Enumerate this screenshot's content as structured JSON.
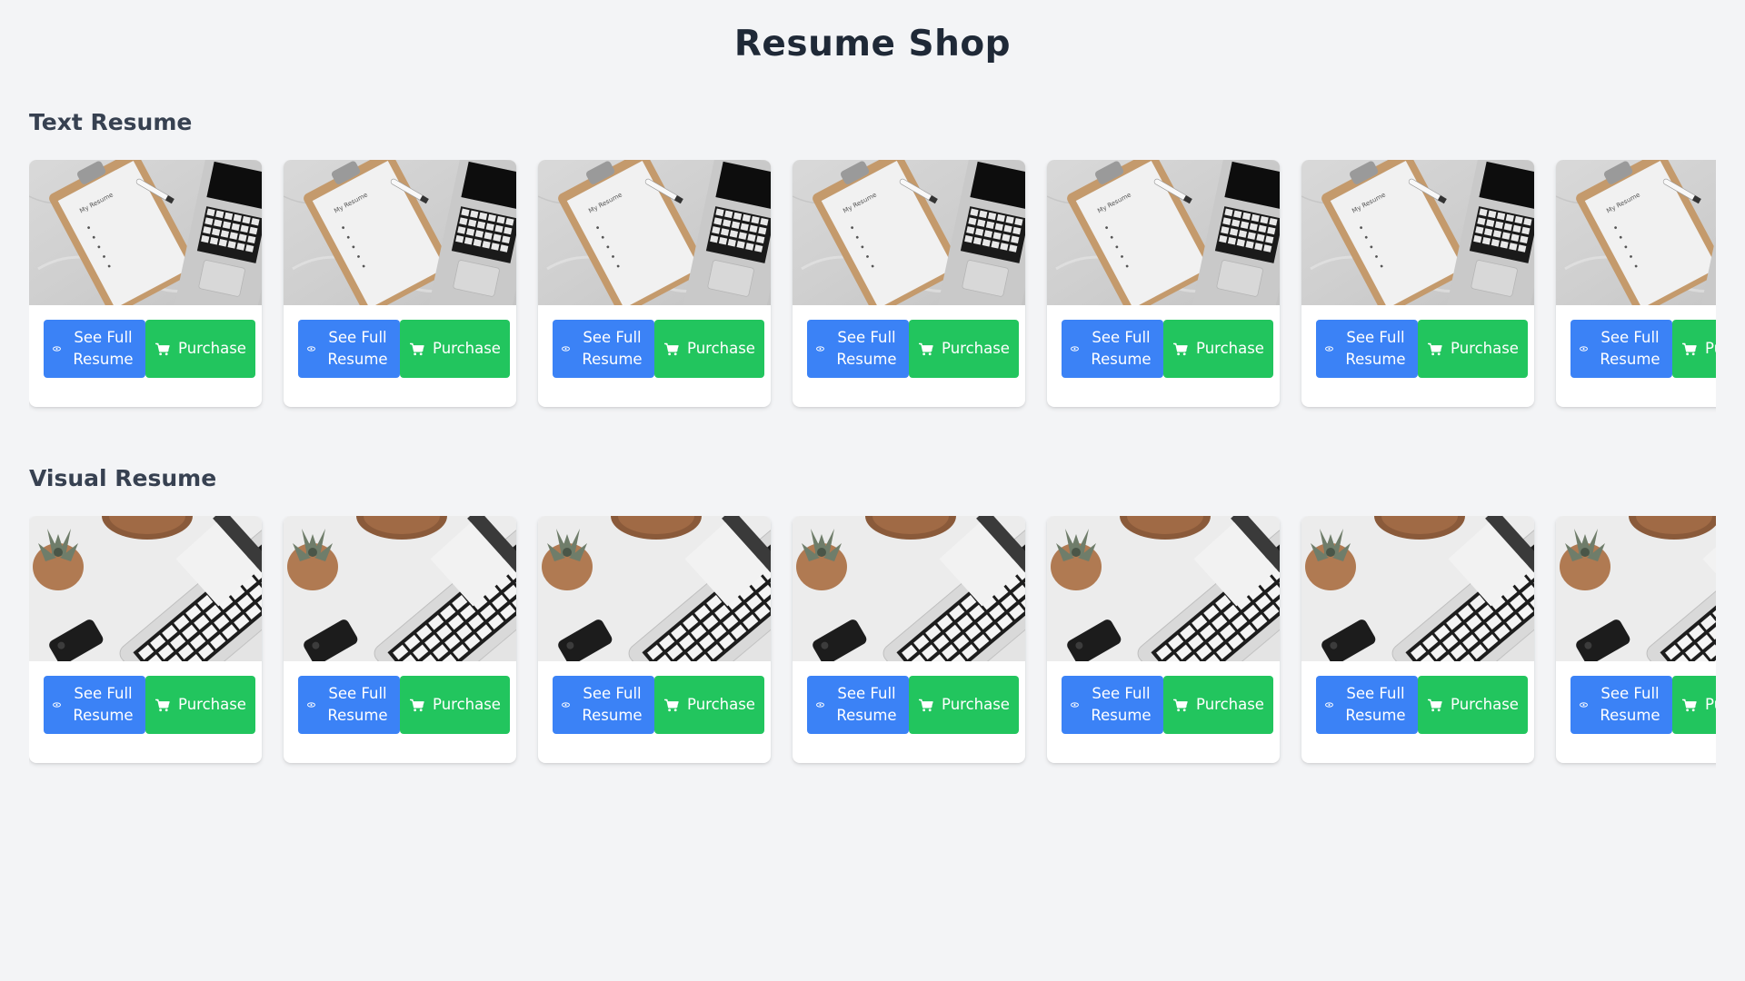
{
  "page": {
    "title": "Resume Shop"
  },
  "sections": [
    {
      "title": "Text Resume",
      "image_kind": "clipboard-laptop",
      "cards": [
        {
          "view_label": "See Full Resume",
          "buy_label": "Purchase"
        },
        {
          "view_label": "See Full Resume",
          "buy_label": "Purchase"
        },
        {
          "view_label": "See Full Resume",
          "buy_label": "Purchase"
        },
        {
          "view_label": "See Full Resume",
          "buy_label": "Purchase"
        },
        {
          "view_label": "See Full Resume",
          "buy_label": "Purchase"
        },
        {
          "view_label": "See Full Resume",
          "buy_label": "Purchase"
        },
        {
          "view_label": "See Full Resume",
          "buy_label": "Purchase"
        }
      ]
    },
    {
      "title": "Visual Resume",
      "image_kind": "laptop-plant-phone",
      "cards": [
        {
          "view_label": "See Full Resume",
          "buy_label": "Purchase"
        },
        {
          "view_label": "See Full Resume",
          "buy_label": "Purchase"
        },
        {
          "view_label": "See Full Resume",
          "buy_label": "Purchase"
        },
        {
          "view_label": "See Full Resume",
          "buy_label": "Purchase"
        },
        {
          "view_label": "See Full Resume",
          "buy_label": "Purchase"
        },
        {
          "view_label": "See Full Resume",
          "buy_label": "Purchase"
        },
        {
          "view_label": "See Full Resume",
          "buy_label": "Purchase"
        }
      ]
    }
  ],
  "icons": {
    "view": "eye-icon",
    "buy": "cart-icon"
  },
  "colors": {
    "background": "#f3f4f6",
    "view_button": "#3b82f6",
    "buy_button": "#22c55e",
    "title_text": "#1f2937",
    "section_text": "#374151"
  }
}
